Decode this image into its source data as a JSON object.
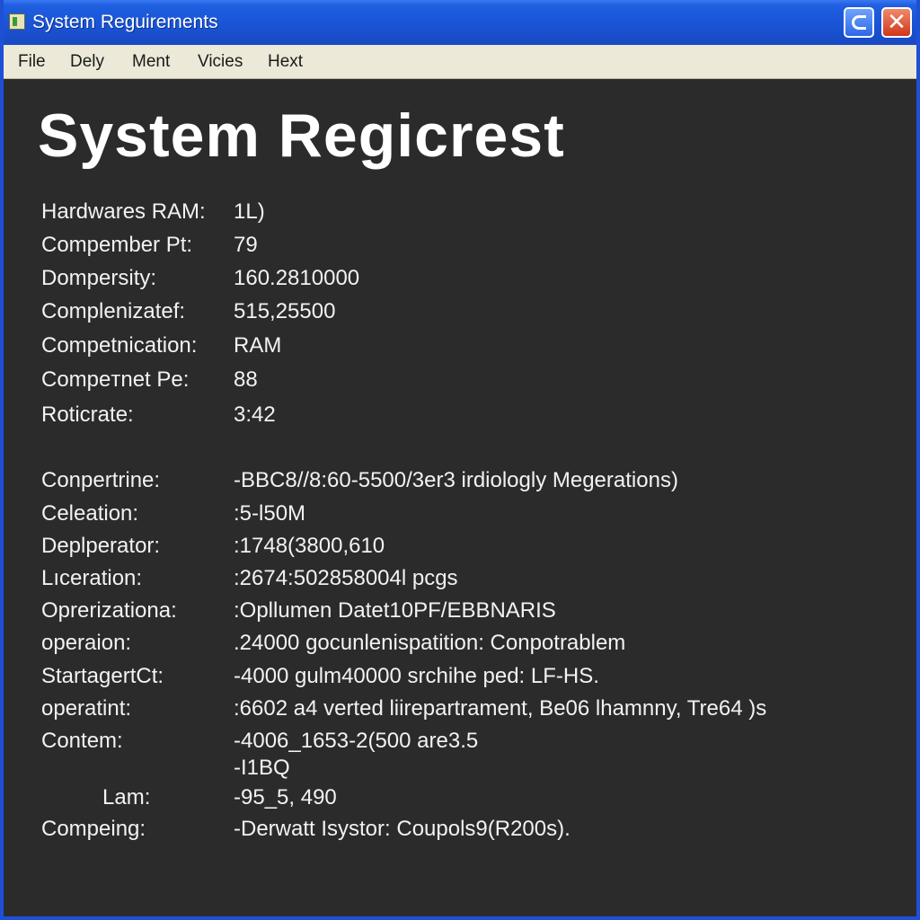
{
  "window": {
    "title": "System Reguirements"
  },
  "menubar": {
    "items": [
      "File",
      "Dely",
      "Ment",
      "Vicies",
      "Hext"
    ]
  },
  "main": {
    "heading": "System Regicrest",
    "group1": [
      {
        "label": "Hardwares RAM:",
        "value": "1L)"
      },
      {
        "label": "Compember Pt:",
        "value": "79"
      },
      {
        "label": "Dompersity:",
        "value": "160.2810000"
      },
      {
        "label": "Complenizatef:",
        "value": "515,25500"
      },
      {
        "label": "Competnication:",
        "value": "RAM"
      },
      {
        "label": "Compeтnet Pe:",
        "value": "88"
      },
      {
        "label": "Roticrate:",
        "value": "3:42"
      }
    ],
    "group2": [
      {
        "label": "Conpertrine:",
        "value": "-BBC8//8:60-5500/3er3 irdiologly Megerations)"
      },
      {
        "label": "Celeation:",
        "value": ":5-l50M"
      },
      {
        "label": "Deplperator:",
        "value": ":1748(3800,610"
      },
      {
        "label": "Lıceration:",
        "value": ":2674:502858004l pcgs"
      },
      {
        "label": "Oprerizationa:",
        "value": ":Opllumen Datet10PF/EBBNARIS"
      },
      {
        "label": "operaion:",
        "value": ".24000 gocunlenispatition: Conpotrablem"
      },
      {
        "label": "StartagertCt:",
        "value": "-4000 gulm40000 srchihe ped: LF-HS."
      },
      {
        "label": "operatint:",
        "value": ":6602 a4 verted liirepartrament,  Be06 lhamnny,  Tre64 )s"
      },
      {
        "label": "Contem:",
        "value": "-4006_1653-2(500 are3.5"
      },
      {
        "label": "",
        "value": "-I1BQ"
      },
      {
        "label": "Lam:",
        "value": "-95_5, 490"
      },
      {
        "label": "Compeing:",
        "value": "-Derwatt Isystor: Coupols9(R200s)."
      }
    ]
  }
}
